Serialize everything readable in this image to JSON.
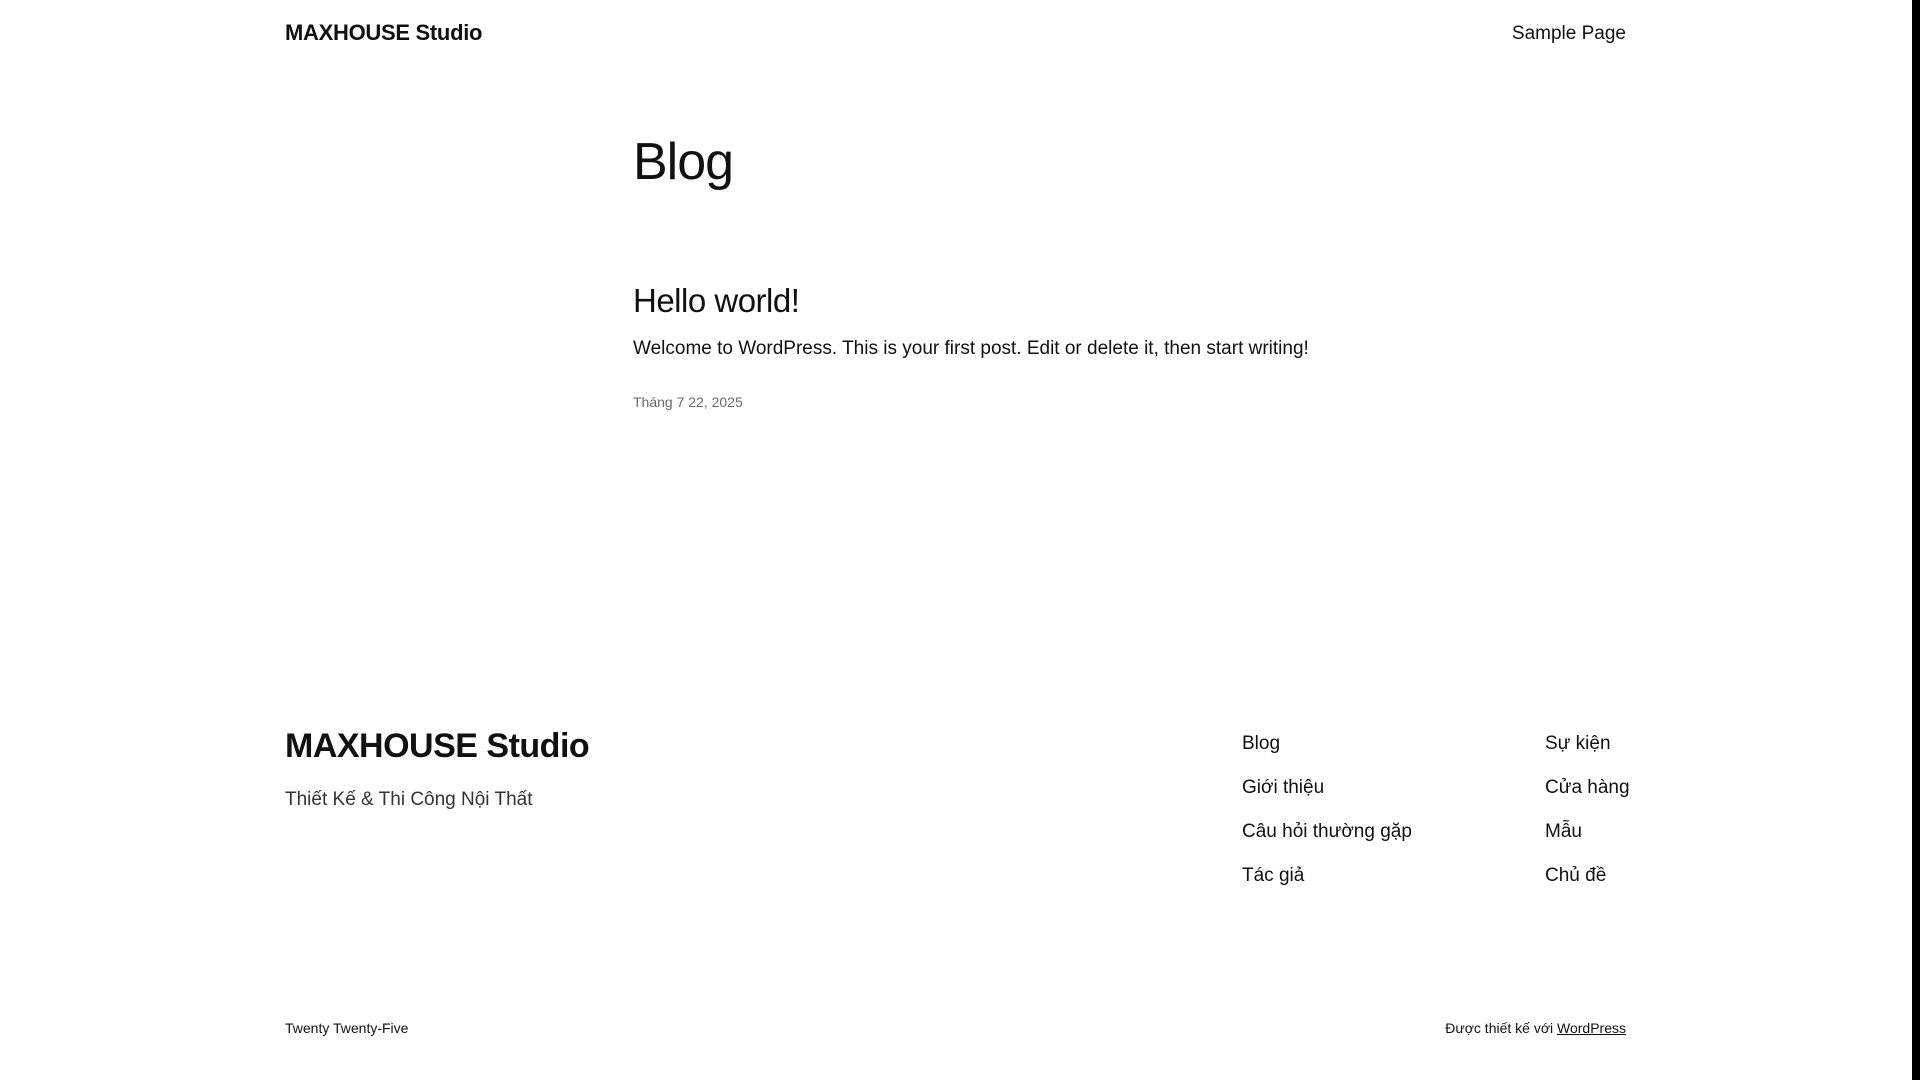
{
  "header": {
    "site_title": "MAXHOUSE Studio",
    "nav_items": [
      "Sample Page"
    ]
  },
  "main": {
    "heading": "Blog",
    "posts": [
      {
        "title": "Hello world!",
        "excerpt": "Welcome to WordPress. This is your first post. Edit or delete it, then start writing!",
        "date": "Tháng 7 22, 2025"
      }
    ]
  },
  "footer": {
    "site_title": "MAXHOUSE Studio",
    "tagline": "Thiết Kế & Thi Công Nội Thất",
    "nav_col_1": [
      "Blog",
      "Giới thiệu",
      "Câu hỏi thường gặp",
      "Tác giả"
    ],
    "nav_col_2": [
      "Sự kiện",
      "Cửa hàng",
      "Mẫu",
      "Chủ đề"
    ],
    "theme_credit": "Twenty Twenty-Five",
    "powered_prefix": "Được thiết kế với",
    "powered_link": "WordPress"
  }
}
